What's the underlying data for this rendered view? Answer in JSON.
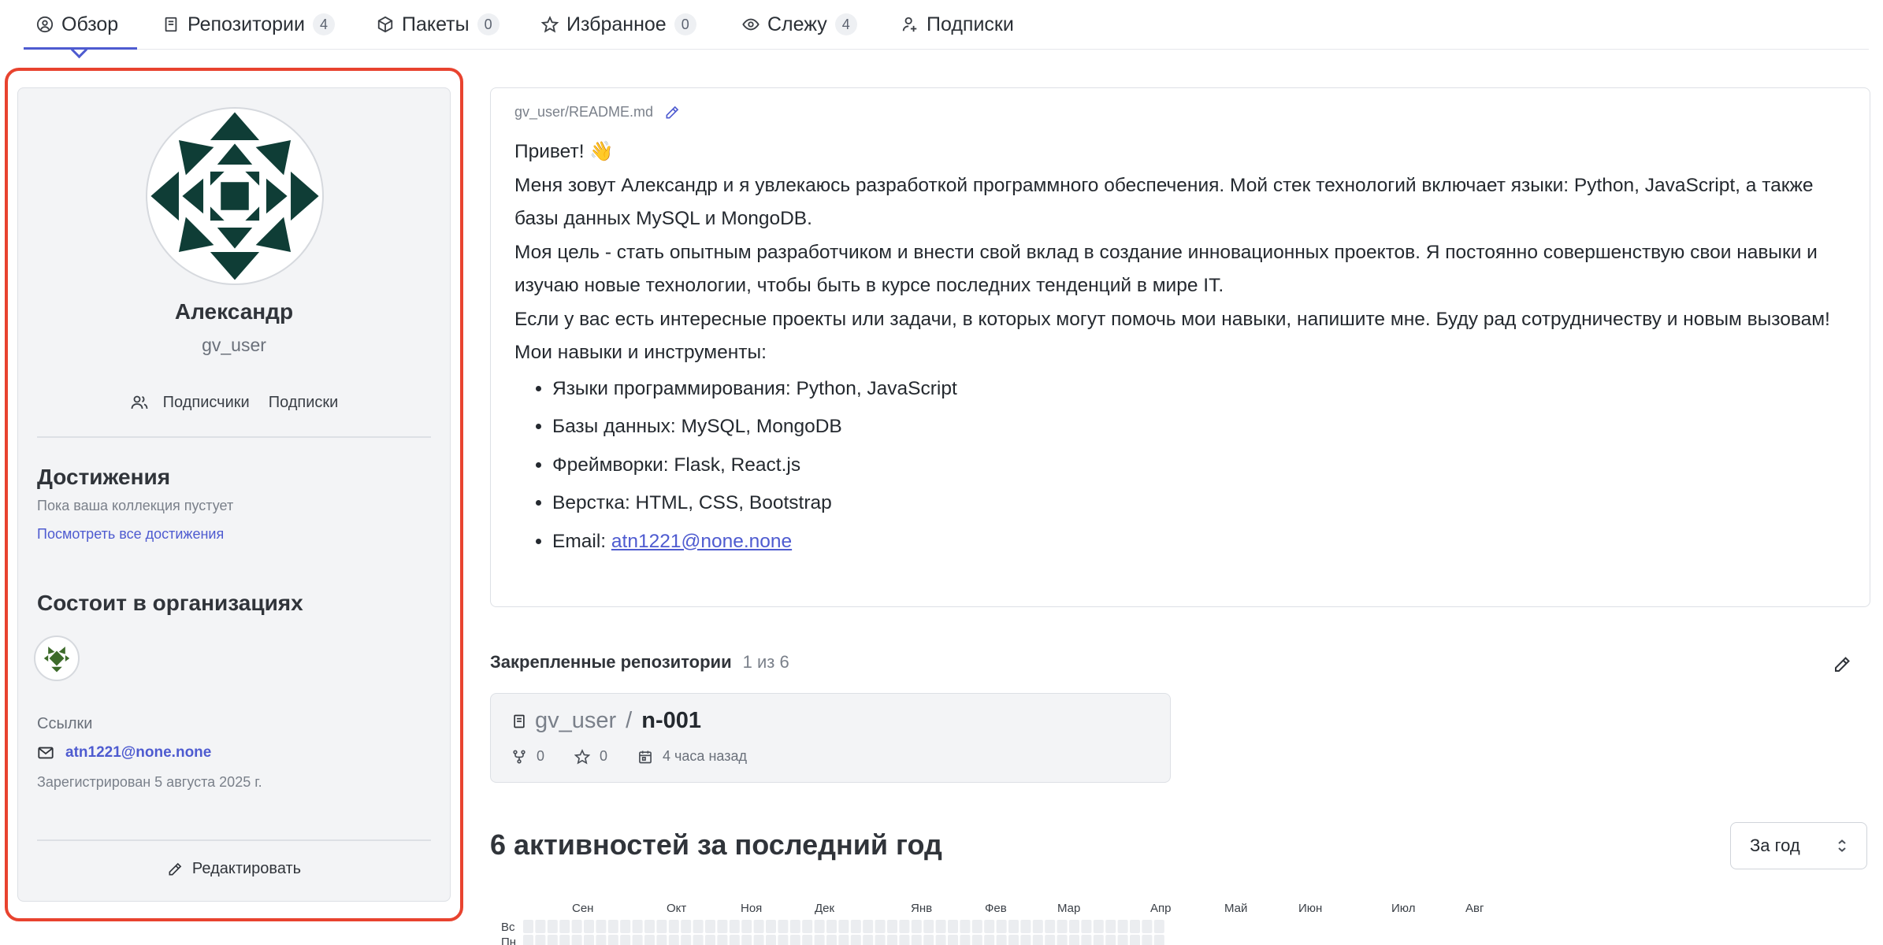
{
  "tabs": [
    {
      "label": "Обзор",
      "count": "",
      "icon": "user-circle-icon",
      "active": true
    },
    {
      "label": "Репозитории",
      "count": "4",
      "icon": "repo-book-icon"
    },
    {
      "label": "Пакеты",
      "count": "0",
      "icon": "package-icon"
    },
    {
      "label": "Избранное",
      "count": "0",
      "icon": "star-icon"
    },
    {
      "label": "Слежу",
      "count": "4",
      "icon": "eye-icon"
    },
    {
      "label": "Подписки",
      "count": "",
      "icon": "user-plus-icon"
    }
  ],
  "profile": {
    "name": "Александр",
    "login": "gv_user",
    "followers_label": "Подписчики",
    "following_label": "Подписки",
    "achievements_title": "Достижения",
    "achievements_empty": "Пока ваша коллекция пустует",
    "achievements_link": "Посмотреть все достижения",
    "orgs_title": "Состоит в организациях",
    "links_title": "Ссылки",
    "email": "atn1221@none.none",
    "registered": "Зарегистрирован 5 августа 2025 г.",
    "edit_label": "Редактировать"
  },
  "readme": {
    "path": "gv_user/README.md",
    "greeting": "Привет! 👋",
    "p1": "Меня зовут Александр и я увлекаюсь разработкой программного обеспечения. Мой стек технологий включает языки: Python, JavaScript, а также базы данных MySQL и MongoDB.",
    "p2": "Моя цель - стать опытным разработчиком и внести свой вклад в создание инновационных проектов. Я постоянно совершенствую свои навыки и изучаю новые технологии, чтобы быть в курсе последних тенденций в мире IT.",
    "p3": "Если у вас есть интересные проекты или задачи, в которых могут помочь мои навыки, напишите мне. Буду рад сотрудничеству и новым вызовам!",
    "skills_title": "Мои навыки и инструменты:",
    "skills": [
      "Языки программирования: Python, JavaScript",
      "Базы данных: MySQL, MongoDB",
      "Фреймворки: Flask, React.js",
      "Верстка: HTML, CSS, Bootstrap"
    ],
    "email_prefix": "Email:",
    "email": "atn1221@none.none"
  },
  "pinned": {
    "title": "Закрепленные репозитории",
    "count": "1 из 6",
    "repo": {
      "owner": "gv_user",
      "slash": "/",
      "name": "n-001",
      "forks": "0",
      "stars": "0",
      "updated": "4 часа назад"
    }
  },
  "activity": {
    "title": "6 активностей за последний год",
    "period_select": "За год",
    "months": [
      "Сен",
      "Окт",
      "Ноя",
      "Дек",
      "Янв",
      "Фев",
      "Мар",
      "Апр",
      "Май",
      "Июн",
      "Июл",
      "Авг"
    ],
    "days": [
      "Вс",
      "Пн"
    ]
  },
  "colors": {
    "accent": "#4e5bd0",
    "highlight_border": "#e8432f",
    "avatar_green": "#0f3d36",
    "org_green": "#3d6b2a",
    "heat_empty": "#ebedf0"
  }
}
